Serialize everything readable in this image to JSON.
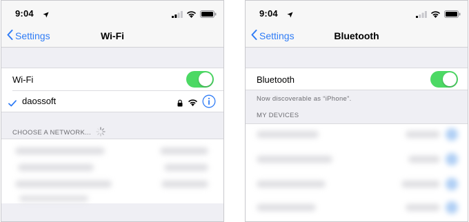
{
  "colors": {
    "accent": "#2f7cf6",
    "toggle_on": "#4cd964",
    "group_bg": "#efeff4"
  },
  "wifi_screen": {
    "status": {
      "time": "9:04"
    },
    "nav": {
      "back_label": "Settings",
      "title": "Wi-Fi"
    },
    "wifi_row": {
      "label": "Wi-Fi",
      "toggle_on": true
    },
    "connected_network": {
      "name": "daossoft",
      "icons": [
        "checkmark-icon",
        "lock-icon",
        "wifi-signal-icon",
        "info-icon"
      ]
    },
    "networks_header": "CHOOSE A NETWORK..."
  },
  "bluetooth_screen": {
    "status": {
      "time": "9:04"
    },
    "nav": {
      "back_label": "Settings",
      "title": "Bluetooth"
    },
    "bluetooth_row": {
      "label": "Bluetooth",
      "toggle_on": true
    },
    "discoverable_note": "Now discoverable as “iPhone”.",
    "devices_header": "MY DEVICES"
  }
}
